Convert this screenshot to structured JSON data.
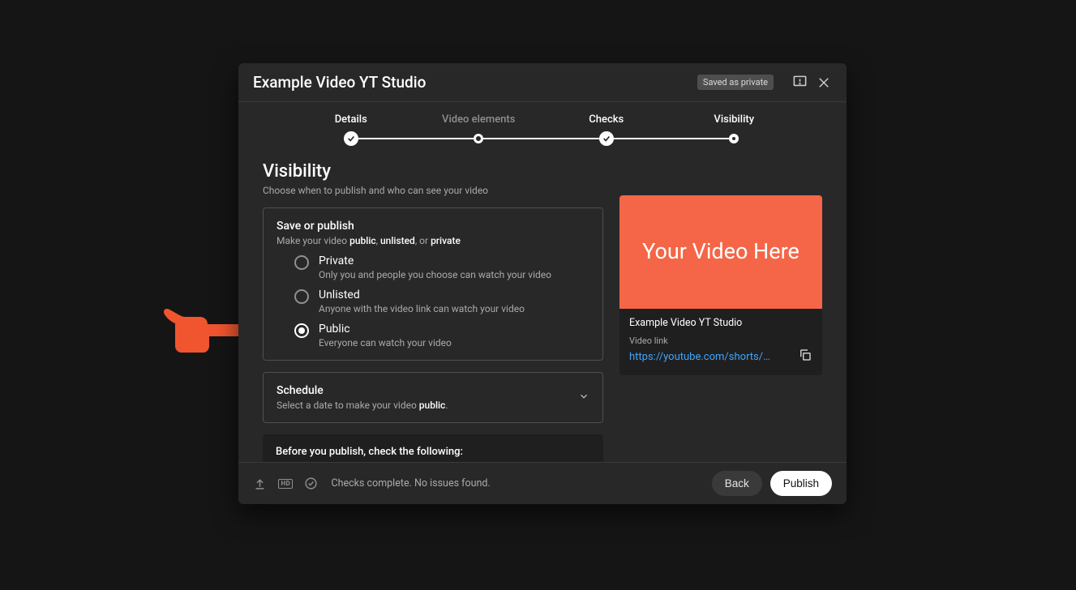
{
  "header": {
    "title": "Example Video YT Studio",
    "save_status": "Saved as private"
  },
  "stepper": {
    "steps": [
      {
        "label": "Details",
        "state": "done"
      },
      {
        "label": "Video elements",
        "state": "next",
        "dim": true
      },
      {
        "label": "Checks",
        "state": "done"
      },
      {
        "label": "Visibility",
        "state": "current"
      }
    ]
  },
  "visibility": {
    "heading": "Visibility",
    "sub": "Choose when to publish and who can see your video",
    "card_title": "Save or publish",
    "card_sub_prefix": "Make your video ",
    "card_sub_words": [
      "public",
      "unlisted",
      "private"
    ],
    "options": [
      {
        "label": "Private",
        "desc": "Only you and people you choose can watch your video",
        "selected": false
      },
      {
        "label": "Unlisted",
        "desc": "Anyone with the video link can watch your video",
        "selected": false
      },
      {
        "label": "Public",
        "desc": "Everyone can watch your video",
        "selected": true
      }
    ],
    "schedule": {
      "title": "Schedule",
      "sub_prefix": "Select a date to make your video ",
      "sub_bold": "public",
      "sub_suffix": "."
    },
    "before_publish": "Before you publish, check the following:"
  },
  "preview": {
    "thumb_text": "Your Video Here",
    "title": "Example Video YT Studio",
    "link_label": "Video link",
    "link": "https://youtube.com/shorts/HK…"
  },
  "footer": {
    "status_text": "Checks complete. No issues found.",
    "back_label": "Back",
    "publish_label": "Publish",
    "hd_label": "HD"
  }
}
